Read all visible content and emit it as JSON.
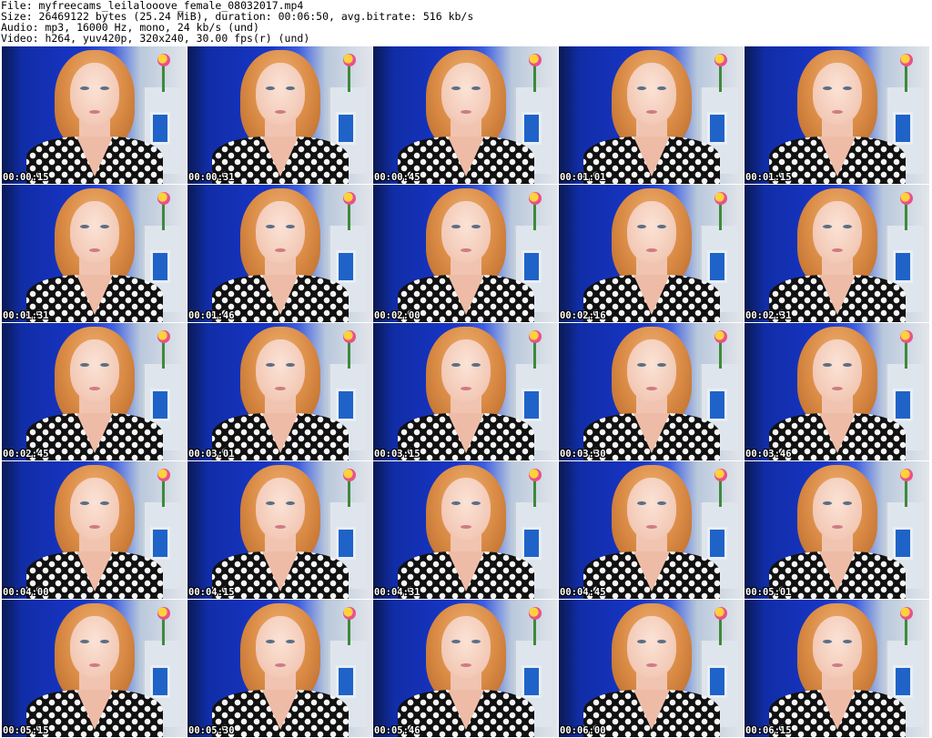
{
  "header": {
    "file_line": "File: myfreecams_leilalooove_female_08032017.mp4",
    "size_line": "Size: 26469122 bytes (25.24 MiB), duration: 00:06:50, avg.bitrate: 516 kb/s",
    "audio_line": "Audio: mp3, 16000 Hz, mono, 24 kb/s (und)",
    "video_line": "Video: h264, yuv420p, 320x240, 30.00 fps(r) (und)"
  },
  "thumbnails": [
    {
      "timestamp": "00:00:15"
    },
    {
      "timestamp": "00:00:31"
    },
    {
      "timestamp": "00:00:45"
    },
    {
      "timestamp": "00:01:01"
    },
    {
      "timestamp": "00:01:15"
    },
    {
      "timestamp": "00:01:31"
    },
    {
      "timestamp": "00:01:46"
    },
    {
      "timestamp": "00:02:00"
    },
    {
      "timestamp": "00:02:16"
    },
    {
      "timestamp": "00:02:31"
    },
    {
      "timestamp": "00:02:45"
    },
    {
      "timestamp": "00:03:01"
    },
    {
      "timestamp": "00:03:15"
    },
    {
      "timestamp": "00:03:30"
    },
    {
      "timestamp": "00:03:46"
    },
    {
      "timestamp": "00:04:00"
    },
    {
      "timestamp": "00:04:15"
    },
    {
      "timestamp": "00:04:31"
    },
    {
      "timestamp": "00:04:45"
    },
    {
      "timestamp": "00:05:01"
    },
    {
      "timestamp": "00:05:15"
    },
    {
      "timestamp": "00:05:30"
    },
    {
      "timestamp": "00:05:46"
    },
    {
      "timestamp": "00:06:00"
    },
    {
      "timestamp": "00:06:15"
    }
  ]
}
